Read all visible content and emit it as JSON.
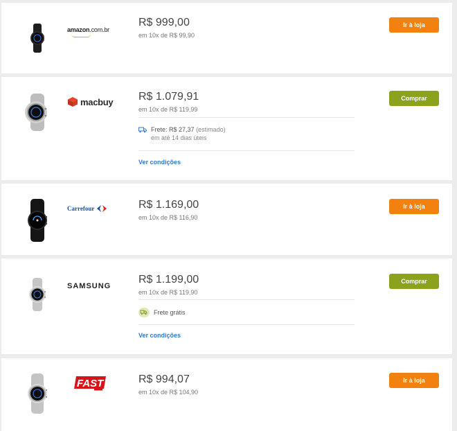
{
  "offers": [
    {
      "store": "amazon.com.br",
      "logo_main": "amazon",
      "logo_suffix": ".com.br",
      "price": "R$ 999,00",
      "installments": "em 10x de R$ 99,90",
      "button": "Ir à loja",
      "button_color": "#f2810f",
      "watch_color": "black-small"
    },
    {
      "store": "macbuy",
      "logo_text": "macbuy",
      "price": "R$ 1.079,91",
      "installments": "em 10x de R$ 119,99",
      "shipping_label": "Frete: R$ 27,37",
      "shipping_note": "(estimado)",
      "shipping_time": "em até 14 dias úteis",
      "conditions_link": "Ver condições",
      "button": "Comprar",
      "button_color": "#8aa21c",
      "watch_color": "silver"
    },
    {
      "store": "Carrefour",
      "logo_text": "Carrefour",
      "price": "R$ 1.169,00",
      "installments": "em 10x de R$ 116,90",
      "button": "Ir à loja",
      "button_color": "#f2810f",
      "watch_color": "black"
    },
    {
      "store": "SAMSUNG",
      "logo_text": "SAMSUNG",
      "price": "R$ 1.199,00",
      "installments": "em 10x de R$ 119,90",
      "shipping_label": "Frete grátis",
      "conditions_link": "Ver condições",
      "button": "Comprar",
      "button_color": "#8aa21c",
      "watch_color": "silver"
    },
    {
      "store": "FAST",
      "logo_text": "FAST",
      "price": "R$ 994,07",
      "installments": "em 10x de R$ 104,90",
      "button": "Ir à loja",
      "button_color": "#f2810f",
      "watch_color": "silver"
    }
  ]
}
